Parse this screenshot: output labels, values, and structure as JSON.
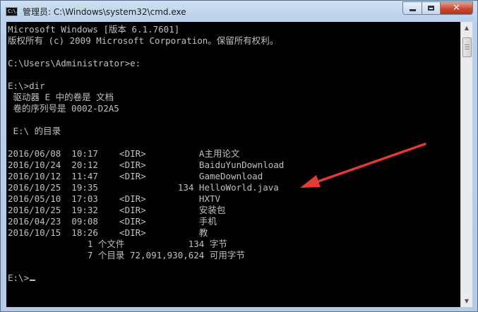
{
  "window": {
    "title": "管理员: C:\\Windows\\system32\\cmd.exe",
    "icon_text": "C:\\.",
    "close_glyph": "✕"
  },
  "console_lines": [
    "Microsoft Windows [版本 6.1.7601]",
    "版权所有 (c) 2009 Microsoft Corporation。保留所有权利。",
    "",
    "C:\\Users\\Administrator>e:",
    "",
    "E:\\>dir",
    " 驱动器 E 中的卷是 文档",
    " 卷的序列号是 0002-D2A5",
    "",
    " E:\\ 的目录",
    "",
    "2016/06/08  10:17    <DIR>          A主用论文",
    "2016/10/24  20:12    <DIR>          BaiduYunDownload",
    "2016/10/12  11:47    <DIR>          GameDownload",
    "2016/10/25  19:35               134 HelloWorld.java",
    "2016/05/10  17:03    <DIR>          HXTV",
    "2016/10/25  19:32    <DIR>          安装包",
    "2016/04/23  09:08    <DIR>          手机",
    "2016/10/15  18:26    <DIR>          教",
    "               1 个文件            134 字节",
    "               7 个目录 72,091,930,624 可用字节",
    "",
    "E:\\>"
  ],
  "annotation": {
    "arrow_color": "#e53935",
    "points_to": "HelloWorld.java"
  },
  "icons": [
    "cmd-app-icon",
    "minimize-icon",
    "maximize-icon",
    "close-icon",
    "scroll-up-icon",
    "scroll-down-icon"
  ]
}
